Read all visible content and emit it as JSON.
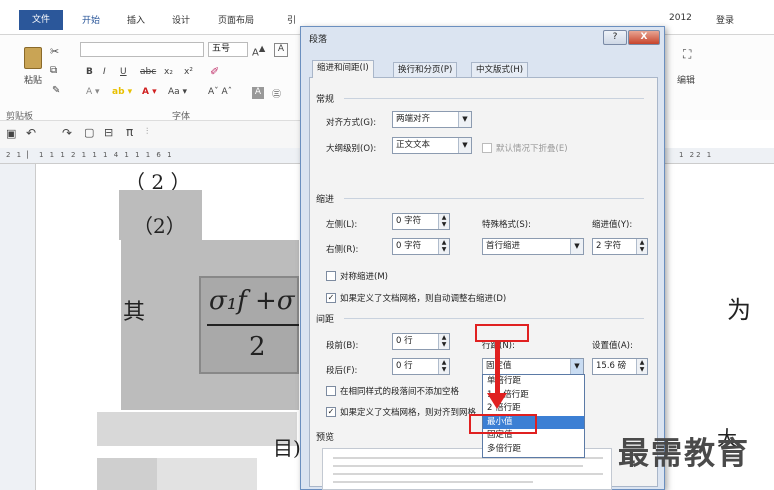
{
  "ribbon": {
    "tabs": [
      "文件",
      "开始",
      "插入",
      "设计",
      "页面布局",
      "引"
    ],
    "right_tabs": [
      "2012",
      "登录"
    ],
    "font_size": "五号",
    "format_buttons": [
      "B",
      "I",
      "U",
      "abc",
      "x₂",
      "x²"
    ],
    "paste_label": "粘贴",
    "clipboard_label": "剪贴板",
    "font_group_label": "字体",
    "edit_label": "编辑",
    "qat_pi": "π"
  },
  "ruler": {
    "left_marks": "2 1 ▏ 1 1 1 2 1 1 1 4 1 1 1 6 1",
    "right_marks": "1 22 1"
  },
  "document": {
    "paren_label": "（2）",
    "qi": "其",
    "wei": "为",
    "formula_num": "σ₁f +σ",
    "formula_den": "2",
    "top_fragment": "（      2      ）",
    "bottom_fragment": "目)",
    "bottom_right_fragment": "大"
  },
  "dialog": {
    "title": "段落",
    "help": "?",
    "close": "X",
    "tabs": [
      "缩进和间距(I)",
      "换行和分页(P)",
      "中文版式(H)"
    ],
    "general": {
      "section": "常规",
      "align_label": "对齐方式(G):",
      "align_value": "两端对齐",
      "outline_label": "大纲级别(O):",
      "outline_value": "正文文本",
      "collapse_label": "默认情况下折叠(E)"
    },
    "indent": {
      "section": "缩进",
      "left_label": "左侧(L):",
      "left_value": "0 字符",
      "right_label": "右侧(R):",
      "right_value": "0 字符",
      "special_label": "特殊格式(S):",
      "special_value": "首行缩进",
      "by_label": "缩进值(Y):",
      "by_value": "2 字符",
      "mirror_label": "对称缩进(M)",
      "auto_adjust_label": "如果定义了文档网格，则自动调整右缩进(D)"
    },
    "spacing": {
      "section": "间距",
      "before_label": "段前(B):",
      "before_value": "0 行",
      "after_label": "段后(F):",
      "after_value": "0 行",
      "line_label": "行距(N):",
      "line_value": "固定值",
      "at_label": "设置值(A):",
      "at_value": "15.6 磅",
      "no_space_label": "在相同样式的段落间不添加空格",
      "snap_label": "如果定义了文档网格，则对齐到网格"
    },
    "dropdown_items": [
      "单倍行距",
      "1.5 倍行距",
      "2 倍行距",
      "最小值",
      "固定值",
      "多倍行距"
    ],
    "dropdown_selected": "最小值",
    "preview_label": "预览"
  },
  "watermark": "最需教育",
  "colors": {
    "accent_blue": "#2b579a",
    "annotation_red": "#e02020",
    "selection_blue": "#3c7fd4"
  }
}
